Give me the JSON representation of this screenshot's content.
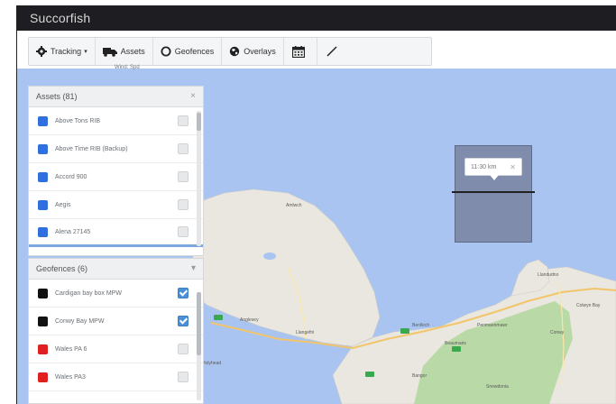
{
  "app": {
    "title": "Succorfish"
  },
  "toolbar": {
    "tracking_label": "Tracking",
    "assets_label": "Assets",
    "geofences_label": "Geofences",
    "overlays_label": "Overlays",
    "subtext": "Wind: Spd"
  },
  "assets_panel": {
    "title": "Assets (81)",
    "items": [
      {
        "label": "Above Tons RIB",
        "color": "#2f6fe0"
      },
      {
        "label": "Above Time RIB (Backup)",
        "color": "#2f6fe0"
      },
      {
        "label": "Accord 900",
        "color": "#2f6fe0"
      },
      {
        "label": "Aegis",
        "color": "#2f6fe0"
      },
      {
        "label": "Alena 27145",
        "color": "#2f6fe0"
      }
    ]
  },
  "geofences_panel": {
    "title": "Geofences (6)",
    "items": [
      {
        "label": "Cardigan bay box MPW",
        "color": "#111111",
        "checked": true
      },
      {
        "label": "Conwy Bay MPW",
        "color": "#111111",
        "checked": true
      },
      {
        "label": "Wales PA 6",
        "color": "#e02020",
        "checked": false
      },
      {
        "label": "Wales PA3",
        "color": "#e02020",
        "checked": false
      }
    ]
  },
  "map": {
    "tooltip_time": "11:30 km",
    "place_labels": [
      "Amlwch",
      "Anglesey",
      "Llangefni",
      "Benllech",
      "Llandudno",
      "Conwy",
      "Bangor",
      "Penmaenmawr",
      "Colwyn Bay",
      "Beaumaris",
      "Holyhead",
      "Snowdonia"
    ]
  }
}
